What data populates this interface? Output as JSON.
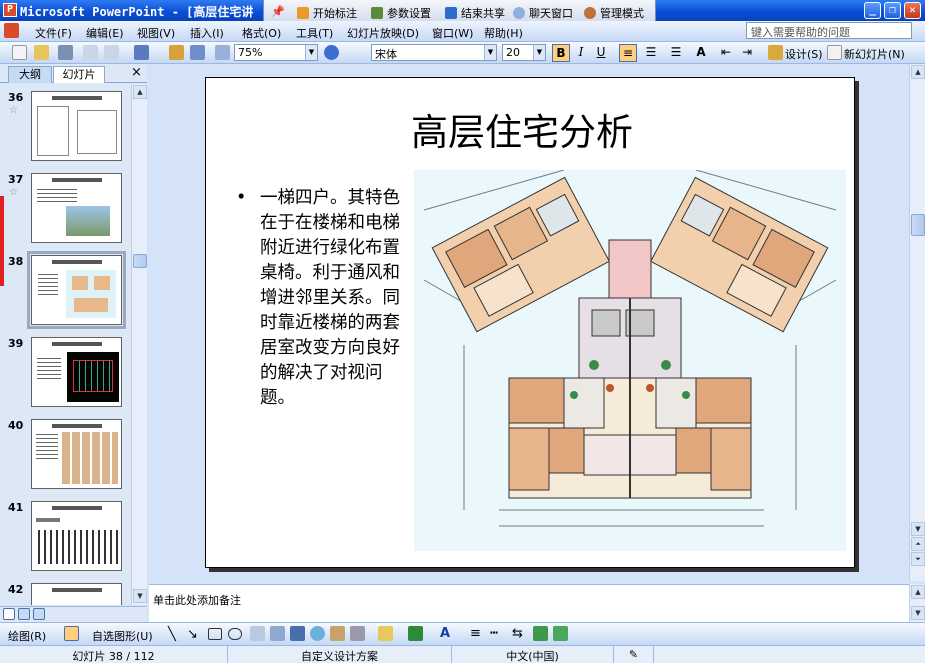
{
  "window": {
    "title": "Microsoft PowerPoint - [高层住宅讲"
  },
  "share_bar": {
    "items": [
      "开始标注",
      "参数设置",
      "结束共享",
      "聊天窗口",
      "管理模式"
    ]
  },
  "menu": {
    "items": [
      "文件(F)",
      "编辑(E)",
      "视图(V)",
      "插入(I)",
      "格式(O)",
      "工具(T)",
      "幻灯片放映(D)",
      "窗口(W)",
      "帮助(H)"
    ],
    "help_placeholder": "键入需要帮助的问题"
  },
  "toolbar": {
    "zoom": "75%",
    "font": "宋体",
    "font_size": "20",
    "bold": "B",
    "italic": "I",
    "underline": "U",
    "design_label": "设计(S)",
    "new_slide_label": "新幻灯片(N)"
  },
  "panel": {
    "tabs": [
      "大纲",
      "幻灯片"
    ],
    "close": "×"
  },
  "thumbnails": [
    {
      "num": "36",
      "selected": false
    },
    {
      "num": "37",
      "selected": false
    },
    {
      "num": "38",
      "selected": true
    },
    {
      "num": "39",
      "selected": false
    },
    {
      "num": "40",
      "selected": false
    },
    {
      "num": "41",
      "selected": false
    },
    {
      "num": "42",
      "selected": false
    }
  ],
  "slide": {
    "title": "高层住宅分析",
    "bullet": "一梯四户。其特色在于在楼梯和电梯附近进行绿化布置桌椅。利于通风和增进邻里关系。同时靠近楼梯的两套居室改变方向良好的解决了对视问题。"
  },
  "notes": {
    "placeholder": "单击此处添加备注"
  },
  "drawing_toolbar": {
    "draw_label": "绘图(R)",
    "autoshapes_label": "自选图形(U)"
  },
  "status": {
    "slide_counter": "幻灯片 38 / 112",
    "design": "自定义设计方案",
    "language": "中文(中国)"
  },
  "colors": {
    "accent_blue": "#0a4fd6",
    "panel_bg": "#dde8f7",
    "selected_button": "#ffcf7c"
  }
}
